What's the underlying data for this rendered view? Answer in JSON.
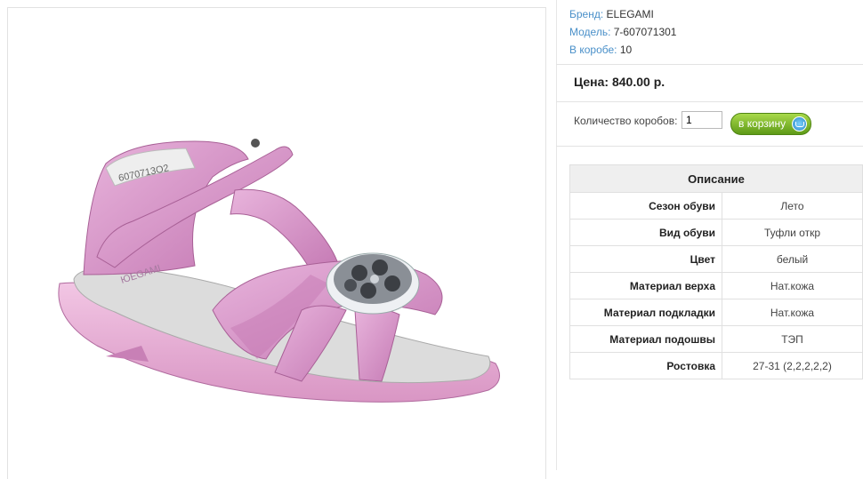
{
  "product": {
    "brand_label": "Бренд:",
    "brand": "ELEGAMI",
    "model_label": "Модель:",
    "model": "7-607071301",
    "box_label": "В коробе:",
    "box": "10",
    "price": "Цена: 840.00 р.",
    "qty_label": "Количество коробов:",
    "qty_value": "1",
    "cart_label": "в корзину",
    "image_sole_text": "6070713О2",
    "image_insole_text": "ЮЕGAMI"
  },
  "description": {
    "title": "Описание",
    "rows": [
      {
        "k": "Сезон обуви",
        "v": "Лето"
      },
      {
        "k": "Вид обуви",
        "v": "Туфли откр"
      },
      {
        "k": "Цвет",
        "v": "белый"
      },
      {
        "k": "Материал верха",
        "v": "Нат.кожа"
      },
      {
        "k": "Материал подкладки",
        "v": "Нат.кожа"
      },
      {
        "k": "Материал подошвы",
        "v": "ТЭП"
      },
      {
        "k": "Ростовка",
        "v": "27-31 (2,2,2,2,2)"
      }
    ]
  },
  "colors": {
    "accent_link": "#4a90c9",
    "shoe_pink": "#d58fc4",
    "button_green": "#7cb830"
  }
}
